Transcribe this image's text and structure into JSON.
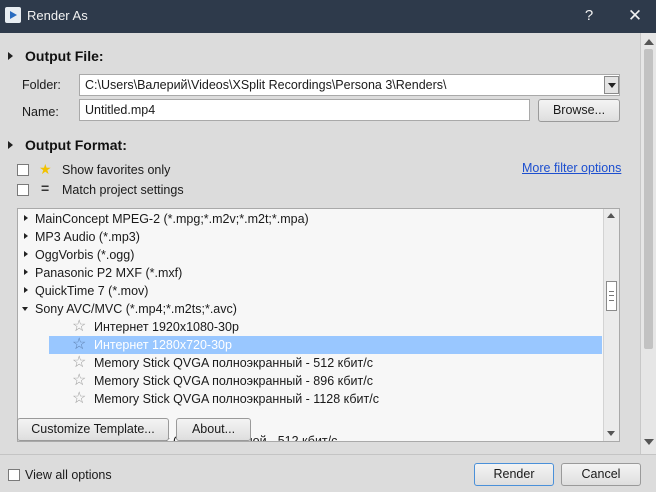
{
  "window": {
    "title": "Render As",
    "help_label": "?",
    "close_label": "✕"
  },
  "output_file": {
    "header": "Output File:",
    "folder_label": "Folder:",
    "folder_value": "C:\\Users\\Валерий\\Videos\\XSplit Recordings\\Persona 3\\Renders\\",
    "name_label": "Name:",
    "name_value": "Untitled.mp4",
    "browse_label": "Browse..."
  },
  "output_format": {
    "header": "Output Format:",
    "show_favorites_label": "Show favorites only",
    "show_favorites_checked": false,
    "match_project_label": "Match project settings",
    "match_project_checked": false,
    "more_filter_label": "More filter options",
    "formats": [
      {
        "label": "MainConcept MPEG-2 (*.mpg;*.m2v;*.m2t;*.mpa)",
        "expanded": false
      },
      {
        "label": "MP3 Audio (*.mp3)",
        "expanded": false
      },
      {
        "label": "OggVorbis (*.ogg)",
        "expanded": false
      },
      {
        "label": "Panasonic P2 MXF (*.mxf)",
        "expanded": false
      },
      {
        "label": "QuickTime 7 (*.mov)",
        "expanded": false
      },
      {
        "label": "Sony AVC/MVC (*.mp4;*.m2ts;*.avc)",
        "expanded": true
      }
    ],
    "templates": [
      {
        "label": "Интернет 1920x1080-30p",
        "selected": false
      },
      {
        "label": "Интернет 1280x720-30p",
        "selected": true
      },
      {
        "label": "Memory Stick QVGA полноэкранный - 512 кбит/с",
        "selected": false
      },
      {
        "label": "Memory Stick QVGA полноэкранный - 896 кбит/с",
        "selected": false
      },
      {
        "label": "Memory Stick QVGA полноэкранный - 1128 кбит/с",
        "selected": false
      },
      {
        "label": "Memory Stick QVGA основной - 512 кбит/с",
        "selected": false
      }
    ],
    "customize_label": "Customize Template...",
    "about_label": "About..."
  },
  "footer": {
    "view_all_label": "View all options",
    "view_all_checked": false,
    "render_label": "Render",
    "cancel_label": "Cancel"
  },
  "icons": {
    "app": "render-app-icon",
    "favorites": "star-icon",
    "match": "equals-icon",
    "template": "star-outline-icon"
  },
  "colors": {
    "titlebar": "#2e3a4b",
    "client": "#dcdcdc",
    "selection": "#99c7ff",
    "link": "#1d4fcf",
    "favorite_star": "#f2c200"
  }
}
